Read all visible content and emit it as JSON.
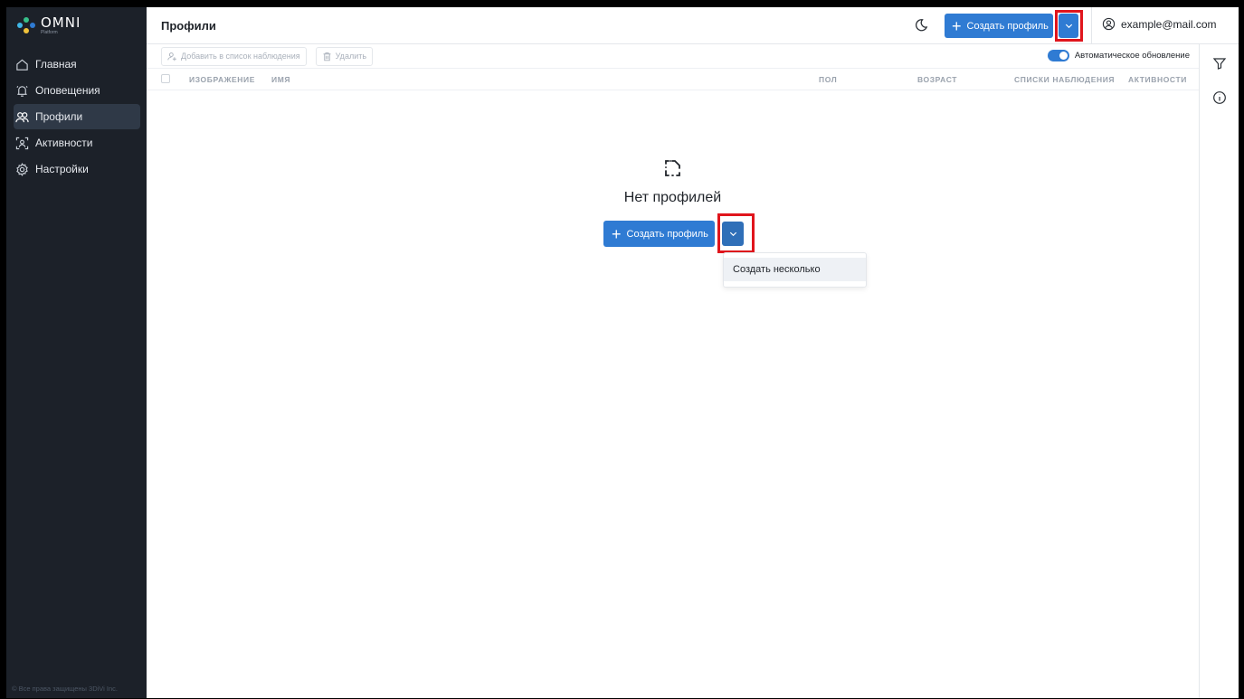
{
  "app": {
    "logo_text": "OMNI",
    "logo_sub": "Platform",
    "footer": "© Все права защищены 3DiVi Inc."
  },
  "colors": {
    "accent": "#2f7bd3",
    "sidebar": "#1c2129",
    "highlight": "#e0151c"
  },
  "sidebar": {
    "items": [
      {
        "label": "Главная",
        "icon": "home-icon",
        "active": false
      },
      {
        "label": "Оповещения",
        "icon": "bell-icon",
        "active": false
      },
      {
        "label": "Профили",
        "icon": "users-icon",
        "active": true
      },
      {
        "label": "Активности",
        "icon": "face-scan-icon",
        "active": false
      },
      {
        "label": "Настройки",
        "icon": "gear-icon",
        "active": false
      }
    ]
  },
  "header": {
    "title": "Профили",
    "create_label": "Создать профиль",
    "user_email": "example@mail.com"
  },
  "toolbar": {
    "add_watchlist_label": "Добавить в список наблюдения",
    "delete_label": "Удалить",
    "auto_update_label": "Автоматическое обновление",
    "auto_update_on": true
  },
  "table": {
    "columns": [
      "ИЗОБРАЖЕНИЕ",
      "ИМЯ",
      "ПОЛ",
      "ВОЗРАСТ",
      "СПИСКИ НАБЛЮДЕНИЯ",
      "АКТИВНОСТИ"
    ]
  },
  "empty": {
    "title": "Нет профилей",
    "create_label": "Создать профиль",
    "menu_items": [
      "Создать несколько"
    ]
  }
}
